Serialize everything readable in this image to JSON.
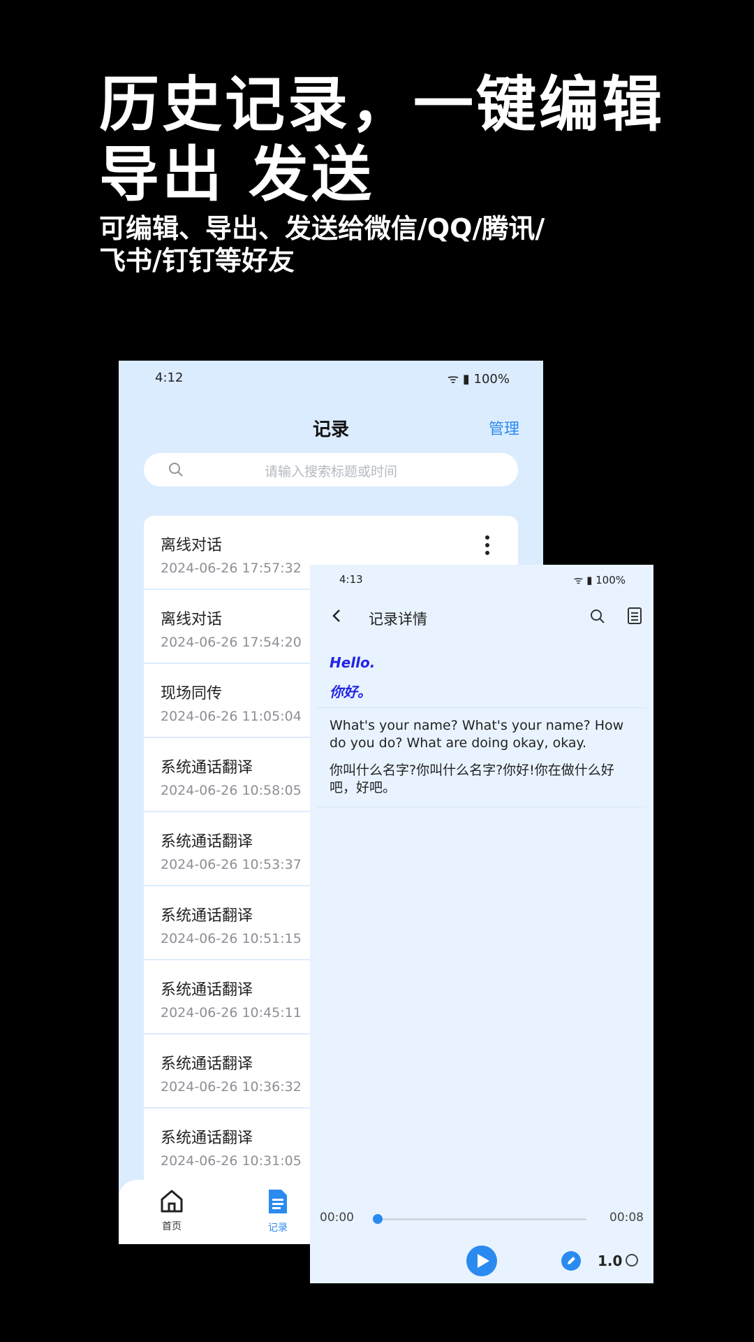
{
  "promo": {
    "headline_line1": "历史记录，一键编辑",
    "headline_line2": "导出 发送",
    "sub_line1": "可编辑、导出、发送给微信/QQ/腾讯/",
    "sub_line2": "飞书/钉钉等好友"
  },
  "list_screen": {
    "status": {
      "time": "4:12",
      "battery": "100%"
    },
    "title": "记录",
    "manage_label": "管理",
    "search_placeholder": "请输入搜索标题或时间",
    "records": [
      {
        "title": "离线对话",
        "datetime": "2024-06-26 17:57:32"
      },
      {
        "title": "离线对话",
        "datetime": "2024-06-26 17:54:20"
      },
      {
        "title": "现场同传",
        "datetime": "2024-06-26 11:05:04"
      },
      {
        "title": "系统通话翻译",
        "datetime": "2024-06-26 10:58:05"
      },
      {
        "title": "系统通话翻译",
        "datetime": "2024-06-26 10:53:37"
      },
      {
        "title": "系统通话翻译",
        "datetime": "2024-06-26 10:51:15"
      },
      {
        "title": "系统通话翻译",
        "datetime": "2024-06-26 10:45:11"
      },
      {
        "title": "系统通话翻译",
        "datetime": "2024-06-26 10:36:32"
      },
      {
        "title": "系统通话翻译",
        "datetime": "2024-06-26 10:31:05"
      }
    ],
    "tabs": [
      {
        "label": "首页",
        "icon": "home-icon"
      },
      {
        "label": "记录",
        "icon": "document-icon",
        "active": true
      }
    ]
  },
  "detail_screen": {
    "status": {
      "time": "4:13",
      "battery": "100%"
    },
    "title": "记录详情",
    "segment1": {
      "source": "Hello.",
      "target": "你好。"
    },
    "segment2": {
      "source": "What's your name? What's your name? How do you do? What are doing okay, okay.",
      "target": "你叫什么名字?你叫什么名字?你好!你在做什么好吧，好吧。"
    },
    "player": {
      "current_time": "00:00",
      "total_time": "00:08",
      "progress": 0,
      "speed": "1.0"
    }
  },
  "colors": {
    "accent": "#2a8af0",
    "highlight_text": "#2323e6",
    "list_background": "#dcecff",
    "detail_background": "#e8f3ff"
  }
}
